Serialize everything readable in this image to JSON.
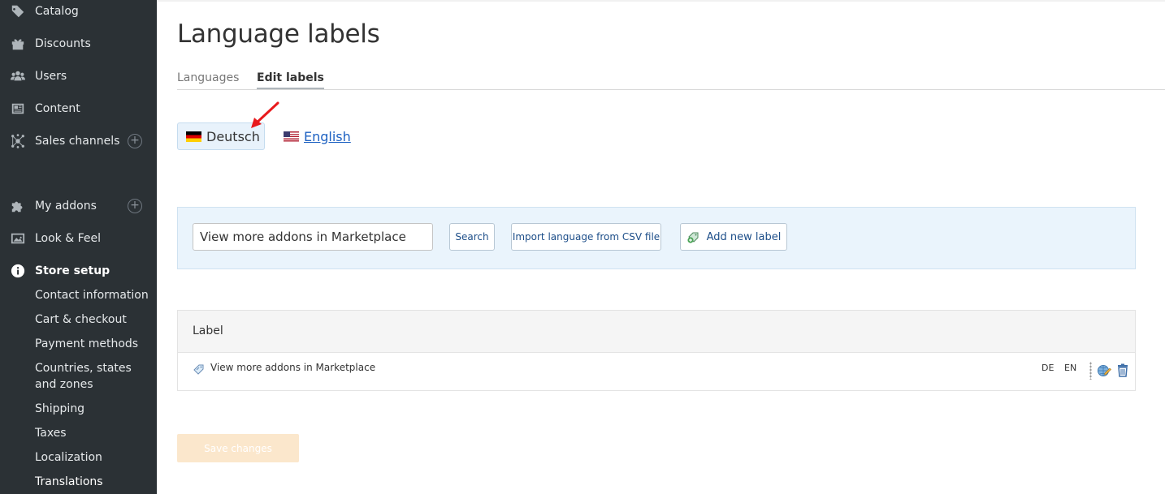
{
  "sidebar": {
    "items": [
      {
        "label": "Catalog",
        "icon": "tag-icon"
      },
      {
        "label": "Discounts",
        "icon": "gift-icon"
      },
      {
        "label": "Users",
        "icon": "users-icon"
      },
      {
        "label": "Content",
        "icon": "newspaper-icon"
      },
      {
        "label": "Sales channels",
        "icon": "network-icon"
      },
      {
        "label": "My addons",
        "icon": "puzzle-icon"
      },
      {
        "label": "Look & Feel",
        "icon": "image-icon"
      },
      {
        "label": "Store setup",
        "icon": "info-icon"
      }
    ],
    "store_setup_sub": [
      "Contact information",
      "Cart & checkout",
      "Payment methods",
      "Countries, states and zones",
      "Shipping",
      "Taxes",
      "Localization",
      "Translations"
    ]
  },
  "main": {
    "title": "Language labels",
    "tabs": [
      {
        "label": "Languages"
      },
      {
        "label": "Edit labels"
      }
    ],
    "languages": [
      {
        "label": "Deutsch"
      },
      {
        "label": "English"
      }
    ],
    "search": {
      "value": "View more addons in Marketplace",
      "search_label": "Search",
      "import_label": "Import language from CSV file",
      "add_label": "Add new label"
    },
    "table": {
      "header": "Label",
      "rows": [
        {
          "label": "View more addons in Marketplace",
          "langs": [
            "DE",
            "EN"
          ]
        }
      ]
    },
    "save_label": "Save changes"
  }
}
